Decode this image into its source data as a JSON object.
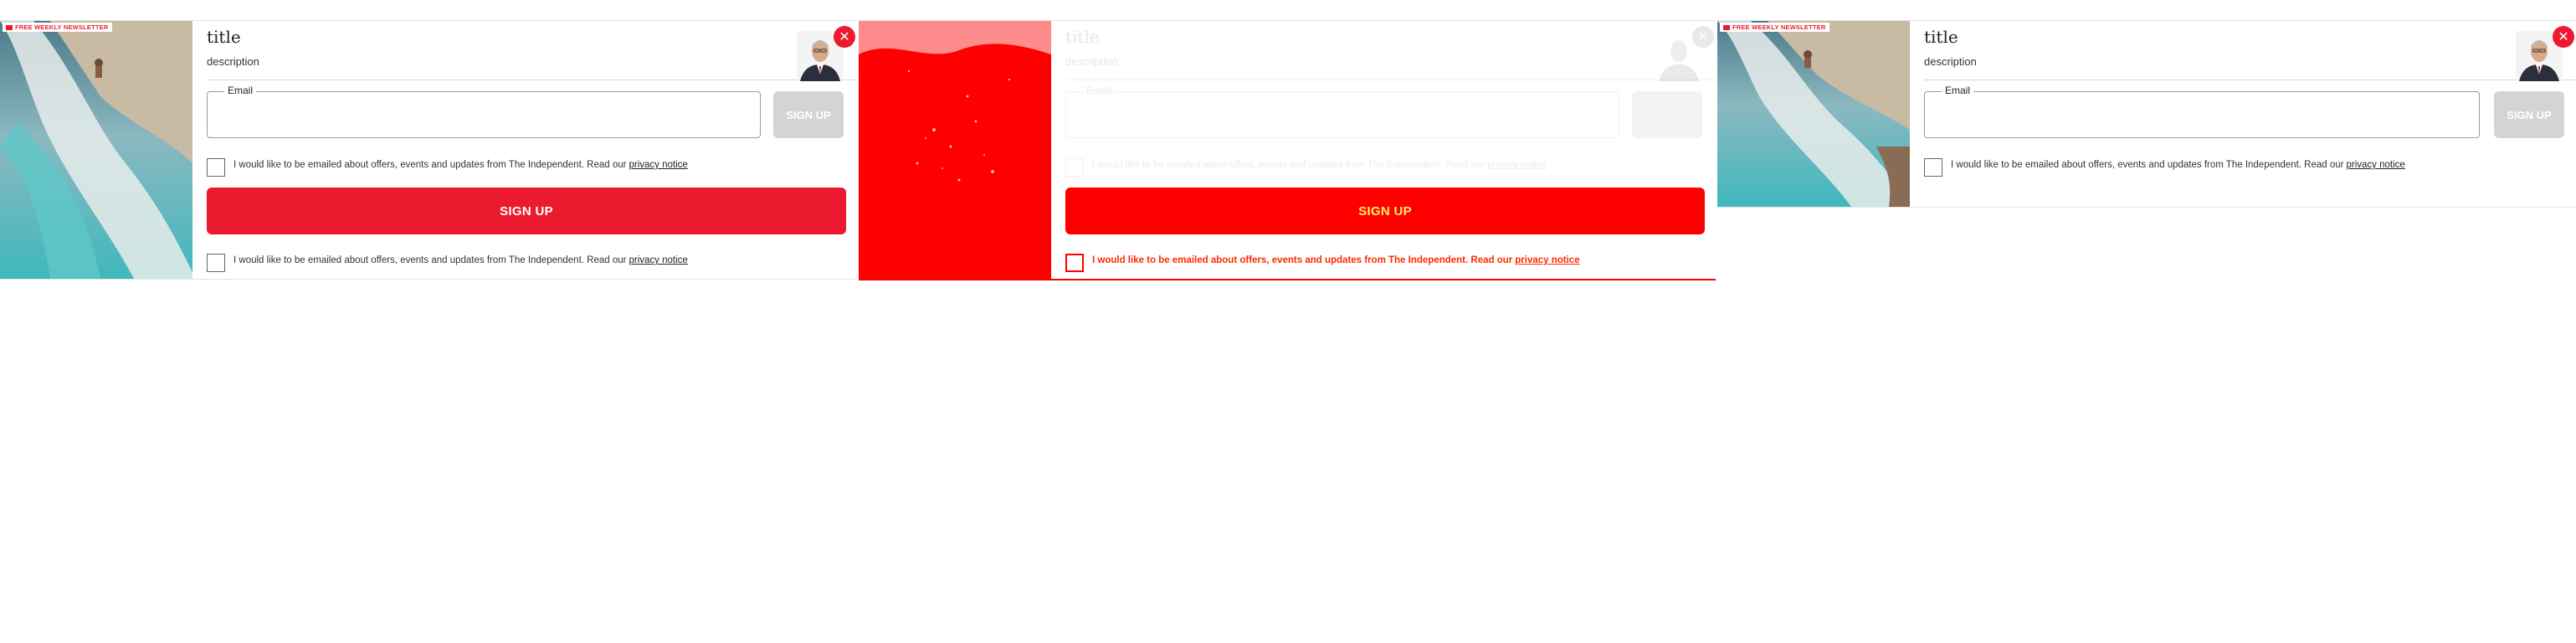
{
  "newsletter": {
    "badge": "FREE WEEKLY NEWSLETTER",
    "title": "title",
    "description": "description",
    "email_label": "Email",
    "email_value": "",
    "signup_label": "SIGN UP",
    "consent_text": "I would like to be emailed about offers, events and updates from The Independent. Read our",
    "privacy_link": "privacy notice"
  },
  "icons": {
    "close": "independent-eagle-close-icon",
    "badge": "envelope-icon"
  },
  "colors": {
    "brand_red": "#ec1a2e",
    "disabled_grey": "#d4d4d4",
    "mask_red": "#ff0000"
  }
}
